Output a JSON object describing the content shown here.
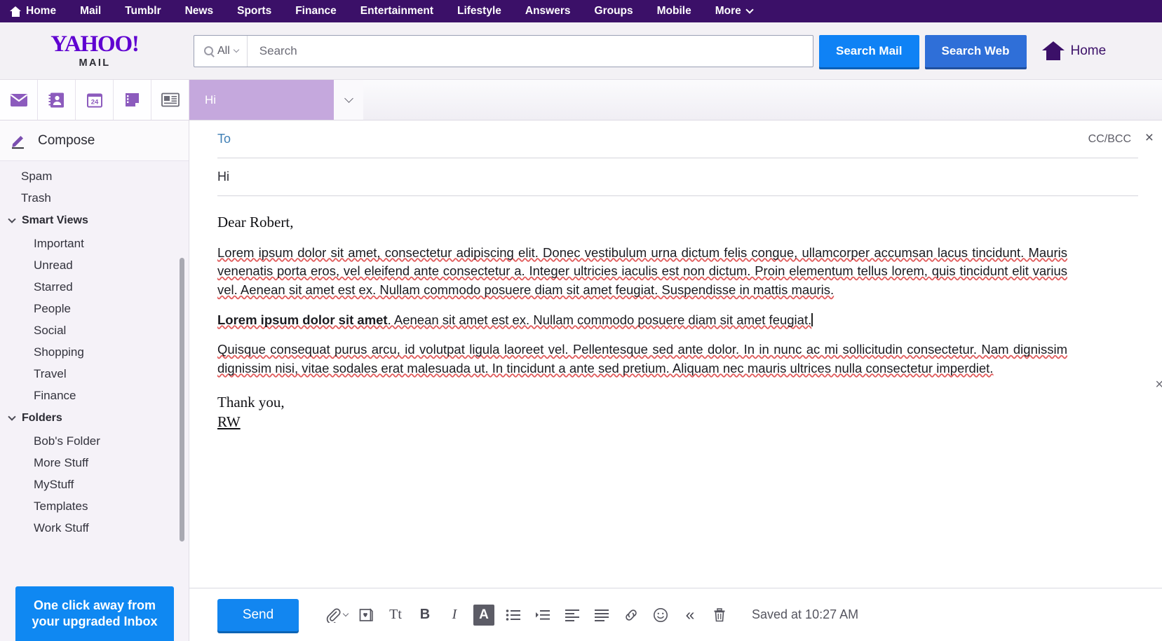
{
  "top_nav": {
    "home_label": "Home",
    "items": [
      "Mail",
      "Tumblr",
      "News",
      "Sports",
      "Finance",
      "Entertainment",
      "Lifestyle",
      "Answers",
      "Groups",
      "Mobile"
    ],
    "more_label": "More"
  },
  "header": {
    "logo_word": "YAHOO!",
    "logo_sub": "MAIL",
    "search_scope": "All",
    "search_placeholder": "Search",
    "search_value": "",
    "search_mail_label": "Search Mail",
    "search_web_label": "Search Web",
    "home_label": "Home",
    "accent_purple": "#3b1068",
    "search_mail_color": "#0f82f5",
    "search_web_color": "#2f6fd8"
  },
  "app_rail": {
    "icons": [
      "mail-icon",
      "contacts-icon",
      "calendar-icon",
      "notepad-icon",
      "news-icon"
    ],
    "calendar_day": "24"
  },
  "tabs": {
    "active_tab_label": "Hi",
    "active_tab_color": "#c5a8dd"
  },
  "sidebar": {
    "compose_label": "Compose",
    "items": [
      {
        "label": "Spam",
        "level": 1
      },
      {
        "label": "Trash",
        "level": 1
      }
    ],
    "smart_views": {
      "label": "Smart Views",
      "items": [
        "Important",
        "Unread",
        "Starred",
        "People",
        "Social",
        "Shopping",
        "Travel",
        "Finance"
      ]
    },
    "folders": {
      "label": "Folders",
      "items": [
        "Bob's Folder",
        "More Stuff",
        "MyStuff",
        "Templates",
        "Work Stuff"
      ]
    },
    "promo": {
      "line1": "One click away from",
      "line2": "your upgraded Inbox",
      "color": "#0f88f2"
    }
  },
  "compose": {
    "to_label": "To",
    "to_value": "",
    "ccbcc_label": "CC/BCC",
    "close_label": "×",
    "subject_value": "Hi",
    "greeting": "Dear Robert,",
    "paragraph1": "Lorem ipsum dolor sit amet, consectetur adipiscing elit. Donec vestibulum urna dictum felis congue, ullamcorper accumsan lacus tincidunt. Mauris venenatis porta eros, vel eleifend ante consectetur a. Integer ultricies iaculis est non dictum. Proin elementum tellus lorem, quis tincidunt elit varius vel. Aenean sit amet est ex. Nullam commodo posuere diam sit amet feugiat. Suspendisse in mattis mauris.",
    "paragraph2_bold": "Lorem ipsum dolor sit amet",
    "paragraph2_rest": ". Aenean sit amet est ex. Nullam commodo posuere diam sit amet feugiat.",
    "paragraph3": "Quisque consequat purus arcu, id volutpat ligula laoreet vel. Pellentesque sed ante dolor. In in nunc ac mi sollicitudin consectetur. Nam dignissim dignissim nisi, vitae sodales erat malesuada ut. In tincidunt a ante sed pretium. Aliquam nec mauris ultrices nulla consectetur imperdiet.",
    "signoff": "Thank you,",
    "signature": "RW"
  },
  "toolbar": {
    "send_label": "Send",
    "icons": [
      "attach-icon",
      "greeting-card-icon",
      "font-size-icon",
      "bold-icon",
      "italic-icon",
      "text-color-icon",
      "bullet-list-icon",
      "indent-icon",
      "align-left-icon",
      "align-justify-icon",
      "link-icon",
      "emoji-icon",
      "collapse-icon",
      "trash-icon"
    ],
    "font_glyph": "Tt",
    "bold_glyph": "B",
    "italic_glyph": "I",
    "color_glyph": "A",
    "collapse_glyph": "«",
    "saved_status": "Saved at 10:27 AM"
  }
}
